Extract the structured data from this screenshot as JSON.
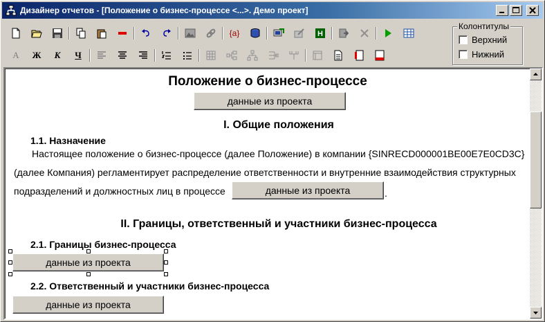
{
  "window": {
    "title": "Дизайнер отчетов - [Положение о бизнес-процессе <...>. Демо проект]",
    "controls": [
      "minimize-icon",
      "maximize-icon",
      "close-icon"
    ]
  },
  "toolbar_row1": [
    {
      "name": "new-document-icon"
    },
    {
      "name": "open-folder-icon"
    },
    {
      "name": "save-icon"
    },
    {
      "name": "copy-icon"
    },
    {
      "name": "paste-icon"
    },
    {
      "name": "delete-icon"
    },
    {
      "name": "undo-icon"
    },
    {
      "name": "redo-icon"
    },
    {
      "name": "image-icon"
    },
    {
      "name": "link-icon"
    },
    {
      "name": "insert-field-icon",
      "text": "{a}"
    },
    {
      "name": "database-icon"
    },
    {
      "name": "import-icon"
    },
    {
      "name": "export-icon"
    },
    {
      "name": "header-icon",
      "text": "H"
    },
    {
      "name": "insert-icon"
    },
    {
      "name": "cancel-icon"
    },
    {
      "name": "run-icon"
    },
    {
      "name": "table-icon"
    }
  ],
  "toolbar_row2": [
    {
      "name": "font-icon",
      "text": "A"
    },
    {
      "name": "bold-icon",
      "text": "Ж"
    },
    {
      "name": "italic-icon",
      "text": "К"
    },
    {
      "name": "underline-icon",
      "text": "Ч"
    },
    {
      "name": "align-left-icon"
    },
    {
      "name": "align-center-icon"
    },
    {
      "name": "align-right-icon"
    },
    {
      "name": "numbered-list-icon"
    },
    {
      "name": "bullet-list-icon"
    },
    {
      "name": "table-grid-icon"
    },
    {
      "name": "tree-left-icon"
    },
    {
      "name": "tree-down-icon"
    },
    {
      "name": "tree-right-icon"
    },
    {
      "name": "tree-branch-icon"
    },
    {
      "name": "form-icon"
    },
    {
      "name": "page-icon"
    },
    {
      "name": "page-break-icon"
    },
    {
      "name": "page-footer-icon"
    }
  ],
  "headers_group": {
    "legend": "Колонтитулы",
    "top_label": "Верхний",
    "bottom_label": "Нижний",
    "top_checked": false,
    "bottom_checked": false
  },
  "document": {
    "title": "Положение о бизнес-процессе",
    "field_label": "данные из проекта",
    "section1": "I. Общие положения",
    "sub1_1": "1.1. Назначение",
    "para1_line1": "Настоящее положение о бизнес-процессе (далее Положение) в компании {SINRECD000001BE00E7E0CD3C}",
    "para1_line2": "(далее Компания) регламентирует распределение ответственности и внутренние взаимодействия структурных",
    "para1_line3": "подразделений и должностных лиц в процессе",
    "para1_end": ".",
    "section2": "II. Границы, ответственный и участники бизнес-процесса",
    "sub2_1": "2.1. Границы бизнес-процесса",
    "sub2_2": "2.2. Ответственный и участники бизнес-процесса"
  }
}
